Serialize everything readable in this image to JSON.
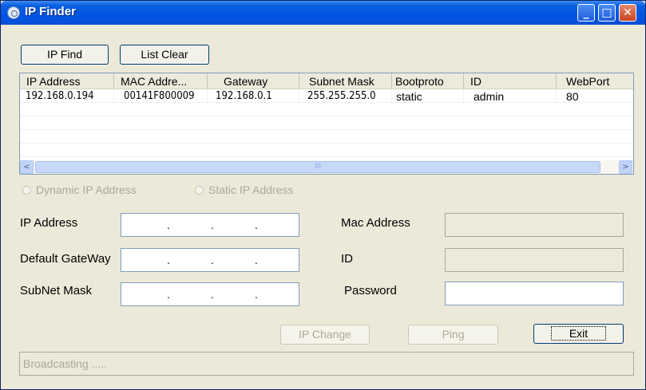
{
  "window": {
    "title": "IP Finder",
    "minimize": "_",
    "maximize": "□",
    "close": "✕"
  },
  "toolbar": {
    "ip_find": "IP Find",
    "list_clear": "List Clear"
  },
  "table": {
    "columns": [
      "IP Address",
      "MAC Addre...",
      "Gateway",
      "Subnet Mask",
      "Bootproto",
      "ID",
      "WebPort"
    ],
    "rows": [
      [
        "192.168.0.194",
        "00141F800009",
        "192.168.0.1",
        "255.255.255.0",
        "static",
        "admin",
        "80"
      ]
    ]
  },
  "scrollbar": {
    "left": "<",
    "right": ">",
    "grip": "III"
  },
  "radios": {
    "dynamic": "Dynamic IP Address",
    "static": "Static IP Address"
  },
  "fields": {
    "ip_address_label": "IP Address",
    "gateway_label": "Default GateWay",
    "subnet_label": "SubNet Mask",
    "mac_label": "Mac Address",
    "id_label": "ID",
    "password_label": "Password",
    "ip_dot": "."
  },
  "buttons": {
    "ip_change": "IP Change",
    "ping": "Ping",
    "exit": "Exit"
  },
  "status": "Broadcasting .....",
  "colors": {
    "titlebar": "#0054e3",
    "face": "#ece9d8",
    "disabled_text": "#aca899"
  }
}
